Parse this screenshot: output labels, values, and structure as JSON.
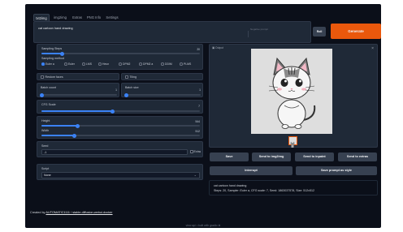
{
  "tabs": [
    "txt2img",
    "img2img",
    "Extras",
    "PNG Info",
    "Settings"
  ],
  "prompt": {
    "value": "cat cartoon hand drawing",
    "negative_placeholder": "Negative prompt"
  },
  "buttons": {
    "roll": "Roll",
    "generate": "Generate"
  },
  "sampling_steps": {
    "label": "Sampling Steps",
    "value": "20",
    "fraction": 0.13
  },
  "sampling_method": {
    "label": "Sampling method",
    "options": [
      "Euler a",
      "Euler",
      "LMS",
      "Heun",
      "DPM2",
      "DPM2 a",
      "DDIM",
      "PLMS"
    ],
    "selected": "Euler a"
  },
  "checkboxes": {
    "restore_faces": "Restore faces",
    "tiling": "Tiling"
  },
  "batch_count": {
    "label": "Batch count",
    "value": "1",
    "fraction": 0.0
  },
  "batch_size": {
    "label": "Batch size",
    "value": "1",
    "fraction": 0.0
  },
  "cfg_scale": {
    "label": "CFG Scale",
    "value": "7",
    "fraction": 0.45
  },
  "height": {
    "label": "Height",
    "value": "544",
    "fraction": 0.23
  },
  "width": {
    "label": "Width",
    "value": "512",
    "fraction": 0.21
  },
  "seed": {
    "label": "Seed",
    "value": "-1",
    "extra_label": "Extra"
  },
  "script": {
    "label": "Script",
    "value": "None"
  },
  "output": {
    "label": "Output",
    "close": "×"
  },
  "actions": [
    "Save",
    "Send to img2img",
    "Send to inpaint",
    "Send to extras"
  ],
  "actions2": [
    "Interrupt",
    "Save prompt as style"
  ],
  "info": {
    "line1": "cat cartoon hand drawing",
    "line2": "Steps: 20, Sampler: Euler a, CFG scale: 7, Seed: 1863037578, Size: 512x512"
  },
  "footer": {
    "created_prefix": "Created by ",
    "created_link": "AUTOMATIC1111 / stable-diffusion-webui-docker",
    "bottom": "view api • built with gradio"
  },
  "colors": {
    "generate": "#ea580c",
    "accent": "#3b82f6",
    "background": "#0b0f19",
    "panel": "#1f2937"
  }
}
